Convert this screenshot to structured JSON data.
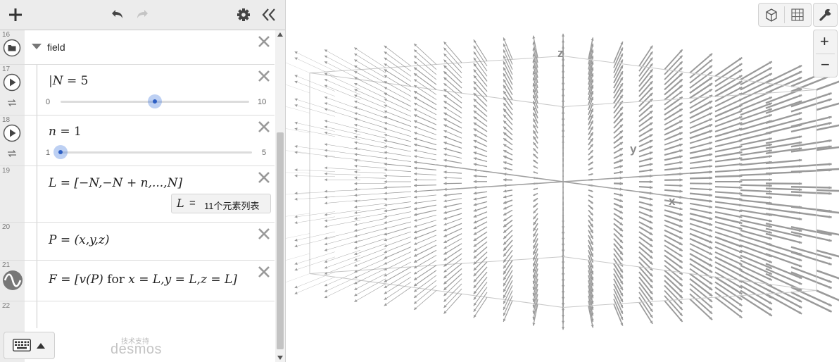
{
  "toolbar": {
    "add_icon": "plus-icon",
    "undo_icon": "undo-icon",
    "redo_icon": "redo-icon",
    "settings_icon": "gear-icon",
    "collapse_icon": "double-chevron-left-icon"
  },
  "expressions": [
    {
      "number": "16",
      "type": "folder",
      "label": "field"
    },
    {
      "number": "17",
      "type": "slider",
      "lhs": "N",
      "rhs": "5",
      "min": "0",
      "max": "10",
      "value": 5
    },
    {
      "number": "18",
      "type": "slider",
      "lhs": "n",
      "rhs": "1",
      "min": "1",
      "max": "5",
      "value": 1
    },
    {
      "number": "19",
      "type": "list",
      "lhs": "L",
      "rhs": "[−N,−N + n,...,N]",
      "eval_lhs": "L",
      "eval_eq": "=",
      "eval_value": "11个元素列表"
    },
    {
      "number": "20",
      "type": "point",
      "lhs": "P",
      "rhs": "(x,y,z)"
    },
    {
      "number": "21",
      "type": "list-comprehension",
      "lhs": "F",
      "rhs_prefix": "[v(P)",
      "rhs_for": "for",
      "rhs_suffix": "x = L,y = L,z = L]"
    },
    {
      "number": "22",
      "type": "empty"
    }
  ],
  "footer": {
    "powered_by": "技术支持",
    "logo": "desmos"
  },
  "graph": {
    "axis_labels": {
      "x": "x",
      "y": "y",
      "z": "z"
    },
    "arrow_color": "#9a9a9a",
    "box_color": "#c8c8c8",
    "axis_color": "#a0a0a0",
    "field": "radial",
    "grid_points_per_axis": 11
  },
  "controls": {
    "view_3d_icon": "cube-icon",
    "view_grid_icon": "grid-icon",
    "wrench_icon": "wrench-icon",
    "zoom_in": "+",
    "zoom_out": "−"
  },
  "colors": {
    "slider_thumb": "#2d5fc4",
    "panel_gutter": "#ececec"
  }
}
